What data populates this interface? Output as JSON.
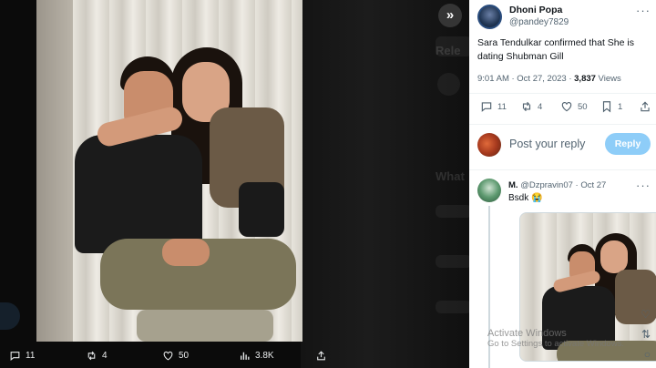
{
  "viewer": {
    "ghost_labels": [
      "Rele",
      "What"
    ],
    "actions": {
      "reply_count": "11",
      "retweet_count": "4",
      "like_count": "50",
      "view_count": "3.8K"
    },
    "icons": [
      "expand-icon",
      "comment-icon",
      "retweet-icon",
      "heart-icon",
      "views-icon",
      "share-icon"
    ]
  },
  "tweet": {
    "display_name": "Dhoni Popa",
    "handle": "@pandey7829",
    "text": "Sara Tendulkar confirmed that She is dating Shubman Gill",
    "time": "9:01 AM · Oct 27, 2023 · ",
    "views_count": "3,837",
    "views_label": " Views",
    "stats": {
      "replies": "11",
      "retweets": "4",
      "likes": "50",
      "bookmarks": "1"
    }
  },
  "reply_box": {
    "placeholder": "Post your reply",
    "button_label": "Reply"
  },
  "comment": {
    "name": "M.",
    "handle_date": " @Dzpravin07 · Oct 27",
    "text": "Bsdk 😭"
  },
  "watermark": {
    "line1": "Activate Windows",
    "line2": "Go to Settings to activate Windows."
  },
  "colors": {
    "accent": "#1d9bf0",
    "reply_button": "#8ecdf8",
    "muted": "#536471"
  }
}
